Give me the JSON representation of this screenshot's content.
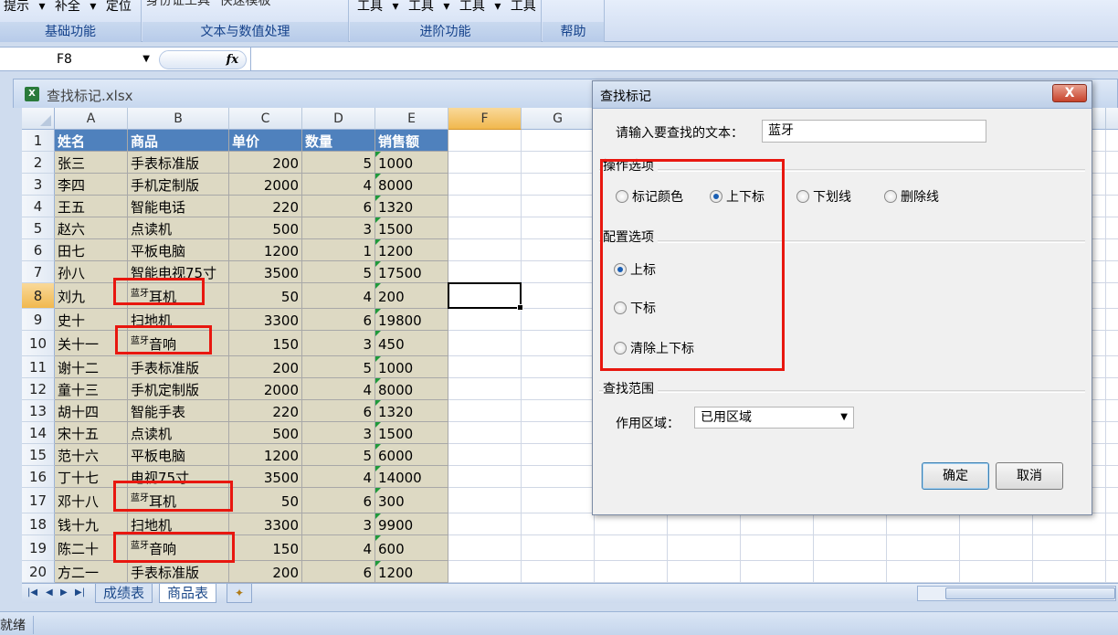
{
  "ribbon": {
    "groups": [
      {
        "items": [
          "提示",
          "补全",
          "定位"
        ],
        "label": "基础功能"
      },
      {
        "items": [
          "身份证工具",
          "快速模板"
        ],
        "label": "文本与数值处理"
      },
      {
        "items": [
          "工具",
          "工具",
          "工具",
          "工具"
        ],
        "label": "进阶功能"
      },
      {
        "items": [],
        "label": "帮助"
      }
    ]
  },
  "formula_bar": {
    "name_box": "F8",
    "fx": "fx",
    "formula": ""
  },
  "workbook": {
    "title": "查找标记.xlsx"
  },
  "sheet": {
    "columns": [
      "A",
      "B",
      "C",
      "D",
      "E",
      "F",
      "G"
    ],
    "header_row": [
      "姓名",
      "商品",
      "单价",
      "数量",
      "销售额"
    ],
    "rows": [
      {
        "num": "2",
        "name": "张三",
        "sup": "",
        "product": "手表标准版",
        "price": "200",
        "qty": "5",
        "sales": "1000"
      },
      {
        "num": "3",
        "name": "李四",
        "sup": "",
        "product": " 手机定制版",
        "price": "2000",
        "qty": "4",
        "sales": "8000"
      },
      {
        "num": "4",
        "name": "王五",
        "sup": "",
        "product": "智能电话",
        "price": "220",
        "qty": "6",
        "sales": "1320"
      },
      {
        "num": "5",
        "name": "赵六",
        "sup": "",
        "product": "点读机",
        "price": "500",
        "qty": "3",
        "sales": "1500"
      },
      {
        "num": "6",
        "name": "田七",
        "sup": "",
        "product": "平板电脑",
        "price": "1200",
        "qty": "1",
        "sales": "1200"
      },
      {
        "num": "7",
        "name": "孙八",
        "sup": "",
        "product": "智能电视75寸",
        "price": "3500",
        "qty": "5",
        "sales": "17500"
      },
      {
        "num": "8",
        "name": "刘九",
        "sup": "蓝牙",
        "product": "耳机",
        "price": "50",
        "qty": "4",
        "sales": "200"
      },
      {
        "num": "9",
        "name": "史十",
        "sup": "",
        "product": "扫地机",
        "price": "3300",
        "qty": "6",
        "sales": "19800"
      },
      {
        "num": "10",
        "name": "关十一",
        "sup": "蓝牙",
        "product": "音响",
        "price": "150",
        "qty": "3",
        "sales": "450"
      },
      {
        "num": "11",
        "name": "谢十二",
        "sup": "",
        "product": "手表标准版",
        "price": "200",
        "qty": "5",
        "sales": "1000"
      },
      {
        "num": "12",
        "name": "童十三",
        "sup": "",
        "product": "手机定制版",
        "price": "2000",
        "qty": "4",
        "sales": "8000"
      },
      {
        "num": "13",
        "name": "胡十四",
        "sup": "",
        "product": "智能手表",
        "price": "220",
        "qty": "6",
        "sales": "1320"
      },
      {
        "num": "14",
        "name": "宋十五",
        "sup": "",
        "product": "点读机",
        "price": "500",
        "qty": "3",
        "sales": "1500"
      },
      {
        "num": "15",
        "name": "范十六",
        "sup": "",
        "product": "平板电脑",
        "price": "1200",
        "qty": "5",
        "sales": "6000"
      },
      {
        "num": "16",
        "name": "丁十七",
        "sup": "",
        "product": "电视75寸",
        "price": "3500",
        "qty": "4",
        "sales": "14000"
      },
      {
        "num": "17",
        "name": "邓十八",
        "sup": "蓝牙",
        "product": "耳机",
        "price": "50",
        "qty": "6",
        "sales": "300"
      },
      {
        "num": "18",
        "name": "钱十九",
        "sup": "",
        "product": "扫地机",
        "price": "3300",
        "qty": "3",
        "sales": "9900"
      },
      {
        "num": "19",
        "name": "陈二十",
        "sup": "蓝牙",
        "product": "音响",
        "price": "150",
        "qty": "4",
        "sales": "600"
      },
      {
        "num": "20",
        "name": "方二一",
        "sup": "",
        "product": "手表标准版",
        "price": "200",
        "qty": "6",
        "sales": "1200"
      }
    ],
    "selected_cell": "F8",
    "tabs": [
      "成绩表",
      "商品表"
    ],
    "active_tab": "商品表"
  },
  "status": {
    "text": "就绪"
  },
  "dialog": {
    "title": "查找标记",
    "close_label": "X",
    "find_label": "请输入要查找的文本：",
    "find_value": "蓝牙",
    "ops_title": "操作选项",
    "ops": [
      "标记颜色",
      "上下标",
      "下划线",
      "删除线"
    ],
    "ops_selected": "上下标",
    "config_title": "配置选项",
    "config": [
      "上标",
      "下标",
      "清除上下标"
    ],
    "config_selected": "上标",
    "range_title": "查找范围",
    "range_label": "作用区域：",
    "range_value": "已用区域",
    "ok": "确定",
    "cancel": "取消"
  },
  "colors": {
    "header_fill": "#4f81bd",
    "data_fill": "#ddd9c3",
    "highlight": "#e8170f"
  }
}
